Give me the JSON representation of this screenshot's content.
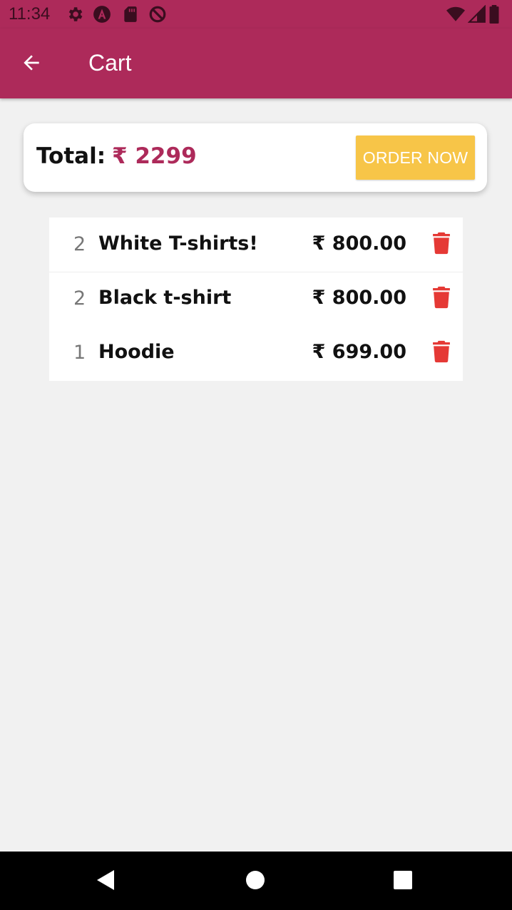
{
  "status_bar": {
    "time": "11:34",
    "left_icons": [
      "gear-icon",
      "a-badge-icon",
      "sd-card-icon",
      "blocked-icon"
    ],
    "right_icons": [
      "wifi-icon",
      "signal-icon",
      "battery-icon"
    ]
  },
  "app_bar": {
    "title": "Cart",
    "back_icon": "arrow-left-icon"
  },
  "total": {
    "label": "Total:",
    "amount": "₹ 2299",
    "order_button": "ORDER NOW"
  },
  "cart": {
    "items": [
      {
        "qty": "2",
        "name": "White T-shirts!",
        "price": "₹ 800.00"
      },
      {
        "qty": "2",
        "name": "Black t-shirt",
        "price": "₹ 800.00"
      },
      {
        "qty": "1",
        "name": "Hoodie",
        "price": "₹ 699.00"
      }
    ]
  },
  "nav_bar": {
    "icons": [
      "back-triangle-icon",
      "home-circle-icon",
      "recents-square-icon"
    ]
  },
  "colors": {
    "primary": "#ad2a5a",
    "accent": "#f7c548",
    "delete": "#e53935",
    "background": "#f1f1f1"
  }
}
